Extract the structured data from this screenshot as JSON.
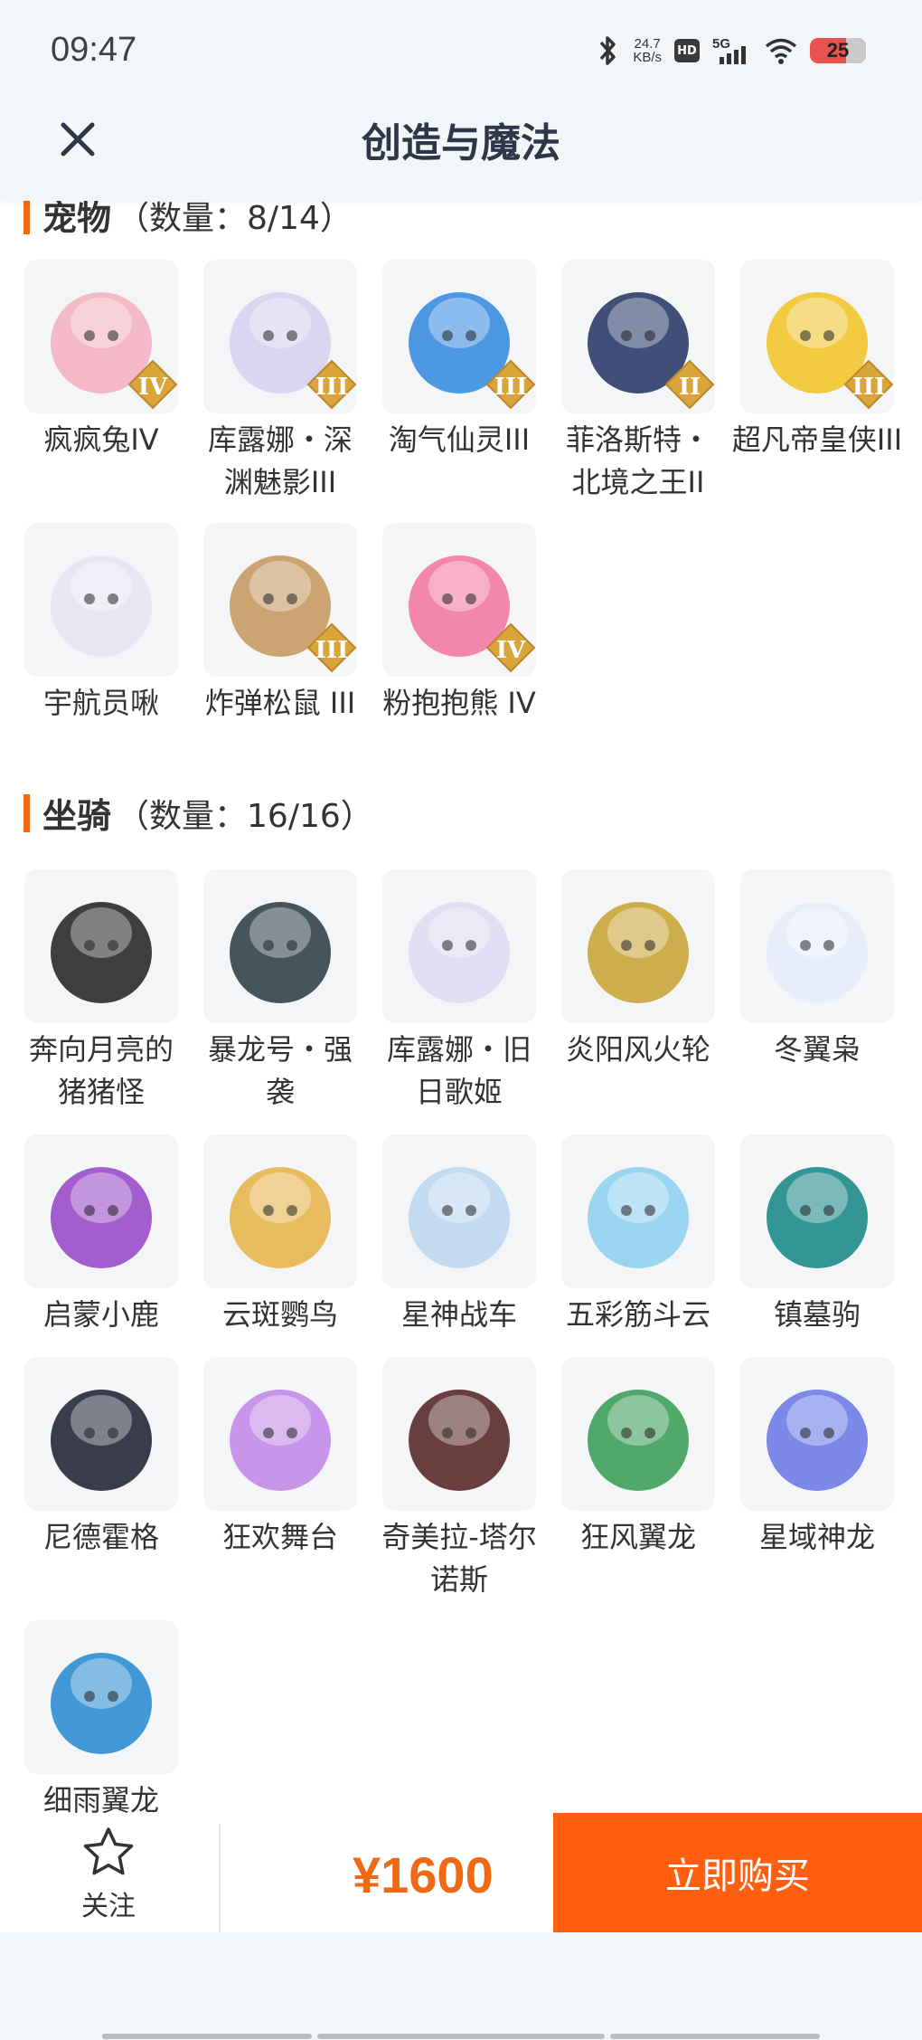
{
  "status_bar": {
    "time": "09:47",
    "net_speed_value": "24.7",
    "net_speed_unit": "KB/s",
    "hd": "HD",
    "signal": "5G",
    "battery": "25"
  },
  "header": {
    "title": "创造与魔法",
    "close_icon": "close-icon"
  },
  "sections": {
    "pets": {
      "name": "宠物",
      "count": "（数量：8/14）",
      "items": [
        {
          "label": "疯疯兔IV",
          "tier": "IV",
          "icon": "pink-bunny",
          "color": "#f4b3c2"
        },
        {
          "label": "库露娜・深渊魅影III",
          "tier": "III",
          "icon": "white-haired-girl",
          "color": "#d7d2f0"
        },
        {
          "label": "淘气仙灵III",
          "tier": "III",
          "icon": "blue-puppy",
          "color": "#3b8ee0"
        },
        {
          "label": "菲洛斯特・北境之王II",
          "tier": "II",
          "icon": "dark-armored-beast",
          "color": "#2c3d6a"
        },
        {
          "label": "超凡帝皇侠III",
          "tier": "III",
          "icon": "gold-armored-hero",
          "color": "#f1c52e"
        },
        {
          "label": "宇航员啾",
          "tier": "",
          "icon": "astronaut-creature",
          "color": "#e7e6f2"
        },
        {
          "label": "炸弹松鼠 III",
          "tier": "III",
          "icon": "bomb-squirrel",
          "color": "#c89b62"
        },
        {
          "label": "粉抱抱熊 IV",
          "tier": "IV",
          "icon": "pink-bear",
          "color": "#f37aa4"
        }
      ]
    },
    "mounts": {
      "name": "坐骑",
      "count": "（数量：16/16）",
      "items": [
        {
          "label": "奔向月亮的猪猪怪",
          "icon": "black-pig",
          "color": "#2a2a2a"
        },
        {
          "label": "暴龙号・强袭",
          "icon": "mech-dragon",
          "color": "#33424a"
        },
        {
          "label": "库露娜・旧日歌姬",
          "icon": "white-haired-girl",
          "color": "#e0dbf2"
        },
        {
          "label": "炎阳风火轮",
          "icon": "golden-wheel",
          "color": "#caa53a"
        },
        {
          "label": "冬翼枭",
          "icon": "snow-owl",
          "color": "#e8eefa"
        },
        {
          "label": "启蒙小鹿",
          "icon": "purple-deer",
          "color": "#9a4cc6"
        },
        {
          "label": "云斑鹦鸟",
          "icon": "golden-parrot",
          "color": "#e7b54e"
        },
        {
          "label": "星神战车",
          "icon": "crystal-horse",
          "color": "#bcd8f0"
        },
        {
          "label": "五彩筋斗云",
          "icon": "blue-cloud",
          "color": "#8fd0f0"
        },
        {
          "label": "镇墓驹",
          "icon": "teal-dragon-horse",
          "color": "#1e8c8a"
        },
        {
          "label": "尼德霍格",
          "icon": "dark-dragon",
          "color": "#262838"
        },
        {
          "label": "狂欢舞台",
          "icon": "heart-stage",
          "color": "#c28be8"
        },
        {
          "label": "奇美拉-塔尔诺斯",
          "icon": "chimera",
          "color": "#5a2a2a"
        },
        {
          "label": "狂风翼龙",
          "icon": "green-wyvern",
          "color": "#3ea05a"
        },
        {
          "label": "星域神龙",
          "icon": "star-dragon",
          "color": "#6f7de6"
        },
        {
          "label": "细雨翼龙",
          "icon": "blue-wyvern",
          "color": "#2f8fd0"
        }
      ]
    }
  },
  "bottom_bar": {
    "follow_label": "关注",
    "price": "¥1600",
    "buy_label": "立即购买"
  },
  "colors": {
    "accent": "#ff5f0f",
    "price": "#f06a14",
    "tier_badge": "#d9a53a"
  }
}
